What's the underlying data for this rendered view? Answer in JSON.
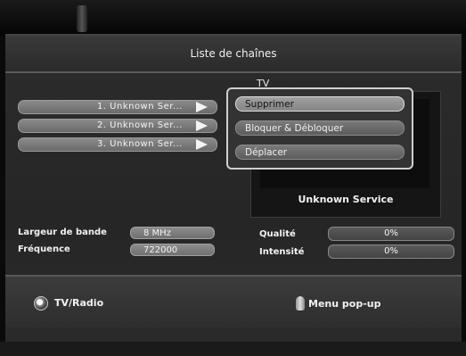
{
  "header": {
    "title": "Liste de chaînes"
  },
  "list_group_label": "TV",
  "channels": [
    {
      "label": "1. Unknown Ser..."
    },
    {
      "label": "2. Unknown Ser..."
    },
    {
      "label": "3. Unknown Ser..."
    }
  ],
  "popup_menu": {
    "items": [
      {
        "label": "Supprimer",
        "selected": true
      },
      {
        "label": "Bloquer & Débloquer",
        "selected": false
      },
      {
        "label": "Déplacer",
        "selected": false
      }
    ]
  },
  "preview": {
    "service_name": "Unknown Service"
  },
  "signal_info": {
    "bandwidth_label": "Largeur de bande",
    "bandwidth_value": "8 MHz",
    "frequency_label": "Fréquence",
    "frequency_value": "722000",
    "quality_label": "Qualité",
    "quality_value": "0%",
    "intensity_label": "Intensité",
    "intensity_value": "0%"
  },
  "footer": {
    "tv_radio_label": "TV/Radio",
    "popup_menu_label": "Menu pop-up"
  },
  "icons": {
    "tv_radio": "circle-button-icon",
    "popup": "hand-pointer-icon",
    "channel_play": "play-arrow-icon"
  }
}
